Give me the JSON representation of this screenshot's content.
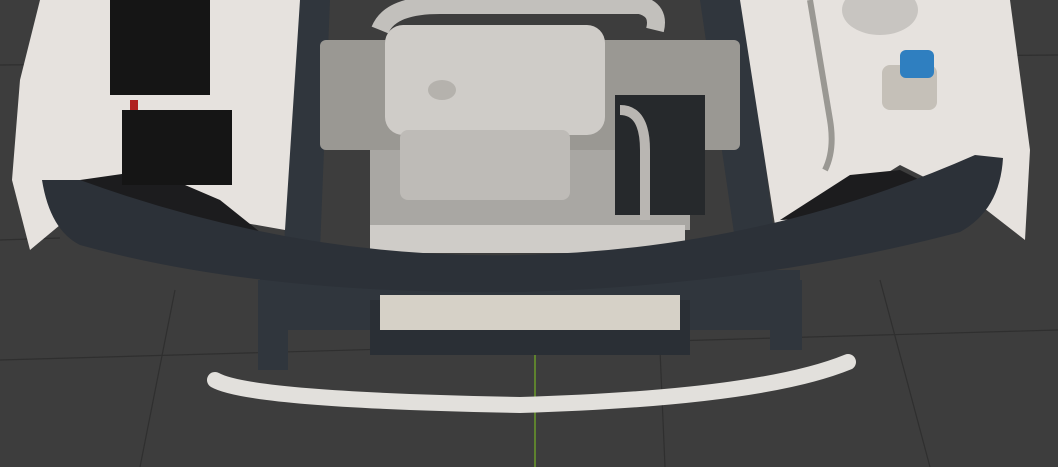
{
  "viewport": {
    "background": "#3d3d3d",
    "grid_color": "#2f2f2f",
    "y_axis_color": "#6a9a2a"
  },
  "model": {
    "body_color": "#e6e2de",
    "bumper_color": "#2c3138",
    "frame_color": "#30363d",
    "engine_color": "#c9c7c3",
    "battery_color": "#151515",
    "cap_color": "#2f7fc0"
  }
}
